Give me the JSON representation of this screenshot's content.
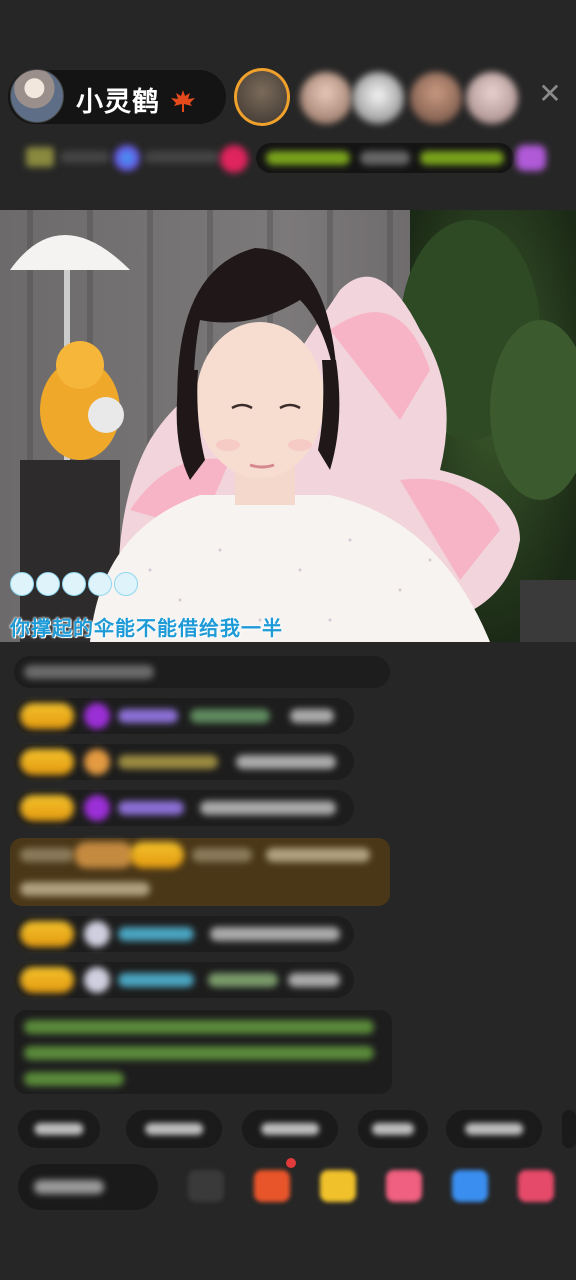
{
  "host": {
    "name": "小灵鹤",
    "name_icon": "maple-leaf-icon",
    "avatar": "host-avatar-image"
  },
  "viewers": [
    "top-viewer-1",
    "top-viewer-2",
    "top-viewer-3",
    "top-viewer-4",
    "top-viewer-5"
  ],
  "controls": {
    "close_icon": "close-icon",
    "close_label": "✕"
  },
  "lyrics": {
    "text": "你撑起的伞能不能借给我一半",
    "dot_count": 5
  },
  "colors": {
    "lyric": "#1e9bd7",
    "badge": "#f3c12b",
    "video_bg": "#5a5758",
    "page_bg": "#262626"
  }
}
